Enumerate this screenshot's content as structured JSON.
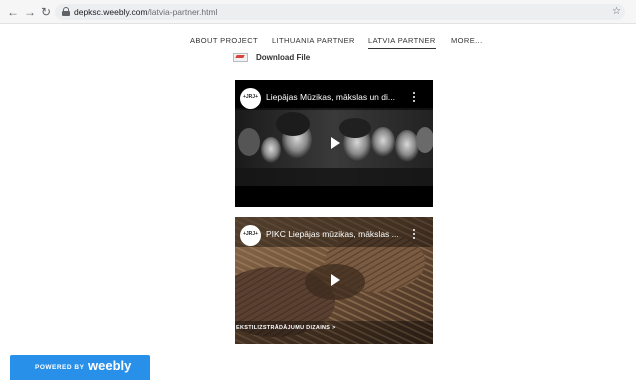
{
  "browser": {
    "back_icon": "arrow-left-icon",
    "forward_icon": "arrow-right-icon",
    "reload_icon": "reload-icon",
    "lock_icon": "lock-icon",
    "url_host": "depksc.weebly.com",
    "url_path": "/latvia-partner.html",
    "star_icon": "star-icon"
  },
  "nav": {
    "items": [
      {
        "label": "ABOUT PROJECT",
        "active": false
      },
      {
        "label": "LITHUANIA PARTNER",
        "active": false
      },
      {
        "label": "LATVIA PARTNER",
        "active": true
      },
      {
        "label": "MORE...",
        "active": false
      }
    ]
  },
  "download": {
    "icon": "pdf-file-icon",
    "label": "Download File"
  },
  "videos": [
    {
      "channel_logo_text": "+JRJ+",
      "title": "Liepājas Mūzikas, mākslas un di...",
      "more_icon": "more-vertical-icon",
      "play_icon": "play-icon",
      "caption": ""
    },
    {
      "channel_logo_text": "+JRJ+",
      "title": "PIKC Liepājas mūzikas, mākslas ...",
      "more_icon": "more-vertical-icon",
      "play_icon": "play-icon",
      "caption": "EKSTILIZSTRĀDĀJUMU DIZAINS  >"
    }
  ],
  "footer": {
    "powered_by": "POWERED BY",
    "brand": "weebly"
  },
  "colors": {
    "badge": "#2990ea",
    "nav_text": "#333333"
  }
}
